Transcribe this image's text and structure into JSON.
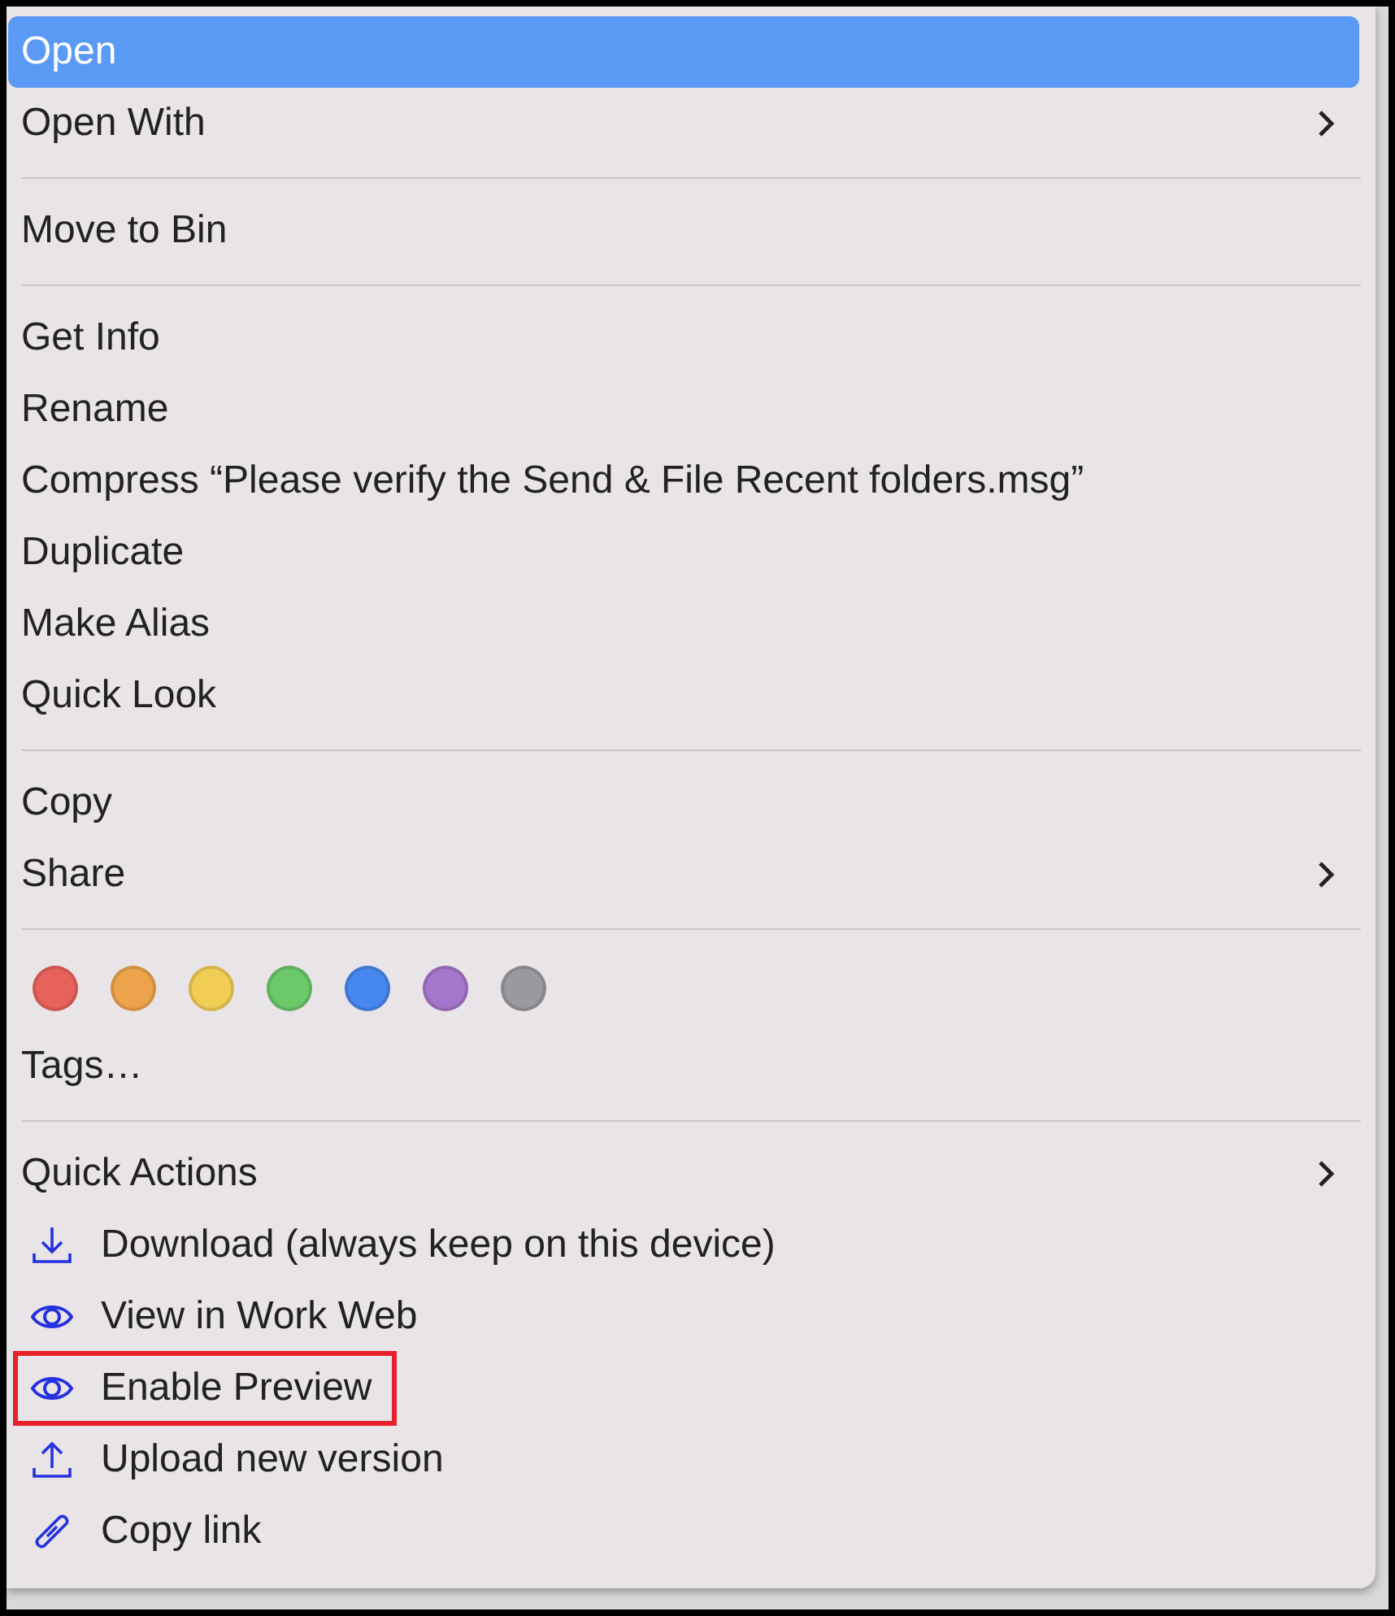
{
  "menu": {
    "items": [
      {
        "kind": "item",
        "label": "Open",
        "selected": true,
        "submenu": false
      },
      {
        "kind": "item",
        "label": "Open With",
        "selected": false,
        "submenu": true
      },
      {
        "kind": "separator"
      },
      {
        "kind": "item",
        "label": "Move to Bin",
        "selected": false,
        "submenu": false
      },
      {
        "kind": "separator"
      },
      {
        "kind": "item",
        "label": "Get Info",
        "selected": false,
        "submenu": false
      },
      {
        "kind": "item",
        "label": "Rename",
        "selected": false,
        "submenu": false
      },
      {
        "kind": "item",
        "label": "Compress “Please verify the Send & File Recent folders.msg”",
        "selected": false,
        "submenu": false
      },
      {
        "kind": "item",
        "label": "Duplicate",
        "selected": false,
        "submenu": false
      },
      {
        "kind": "item",
        "label": "Make Alias",
        "selected": false,
        "submenu": false
      },
      {
        "kind": "item",
        "label": "Quick Look",
        "selected": false,
        "submenu": false
      },
      {
        "kind": "separator"
      },
      {
        "kind": "item",
        "label": "Copy",
        "selected": false,
        "submenu": false
      },
      {
        "kind": "item",
        "label": "Share",
        "selected": false,
        "submenu": true
      },
      {
        "kind": "separator"
      },
      {
        "kind": "tags",
        "colors": [
          {
            "color": "#e8625c"
          },
          {
            "color": "#eda34c"
          },
          {
            "color": "#f2cd55"
          },
          {
            "color": "#6cc96a"
          },
          {
            "color": "#4788ee"
          },
          {
            "color": "#a676cc"
          },
          {
            "color": "#9a999d"
          }
        ]
      },
      {
        "kind": "item",
        "label": "Tags…",
        "selected": false,
        "submenu": false
      },
      {
        "kind": "separator"
      },
      {
        "kind": "item",
        "label": "Quick Actions",
        "selected": false,
        "submenu": true
      },
      {
        "kind": "action",
        "label": "Download (always keep on this device)",
        "outlined": false
      },
      {
        "kind": "action",
        "label": "View in Work Web",
        "outlined": false
      },
      {
        "kind": "action",
        "label": "Enable Preview",
        "outlined": true
      },
      {
        "kind": "action",
        "label": "Upload new version",
        "outlined": false
      },
      {
        "kind": "action",
        "label": "Copy link",
        "outlined": false
      }
    ]
  }
}
